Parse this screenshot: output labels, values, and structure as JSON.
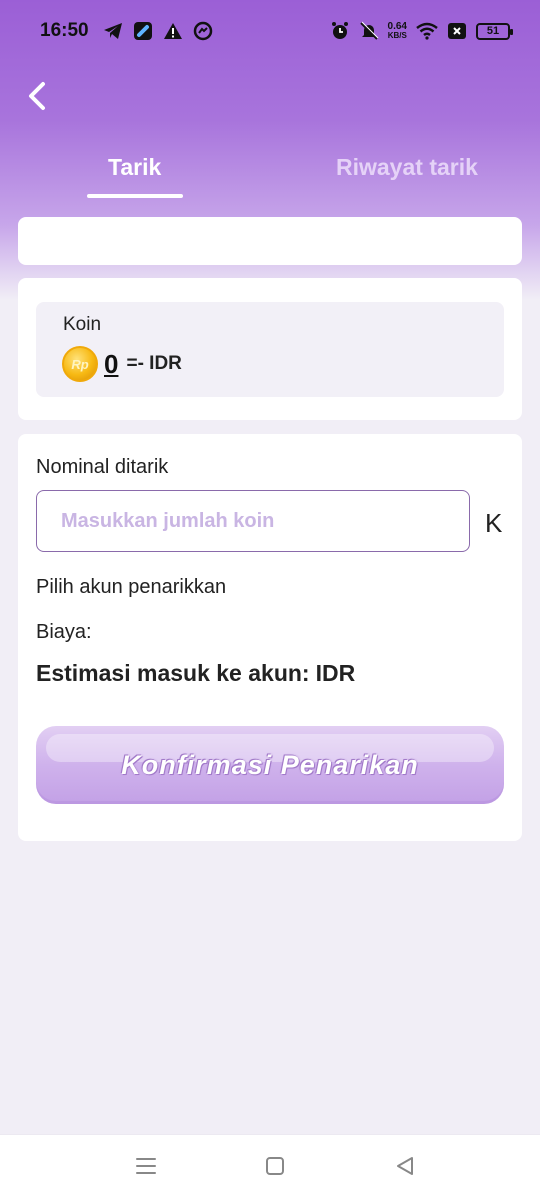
{
  "status_bar": {
    "time": "16:50",
    "net_speed_value": "0.64",
    "net_speed_unit": "KB/S",
    "battery_level": "51"
  },
  "header": {
    "back_icon": "chevron-left-icon"
  },
  "tabs": [
    {
      "label": "Tarik",
      "active": true
    },
    {
      "label": "Riwayat tarik",
      "active": false
    }
  ],
  "coin_card": {
    "label": "Koin",
    "coin_icon_text": "Rp",
    "amount": "0",
    "conversion": "=- IDR"
  },
  "form": {
    "nominal_label": "Nominal ditarik",
    "input_placeholder": "Masukkan jumlah koin",
    "input_value": "",
    "unit": "K",
    "account_label": "Pilih akun penarikkan",
    "fee_label": "Biaya",
    "fee_separator": ":",
    "estimate_label": "Estimasi masuk ke akun:",
    "estimate_currency": "IDR",
    "confirm_label": "Konfirmasi Penarikan"
  },
  "colors": {
    "header_purple": "#9b5fd6",
    "button_purple": "#cfb2ec",
    "input_border": "#8a6aab",
    "coin_gold": "#f7b913"
  },
  "nav_bar": {
    "icons": [
      "menu-icon",
      "home-square-icon",
      "back-triangle-icon"
    ]
  }
}
